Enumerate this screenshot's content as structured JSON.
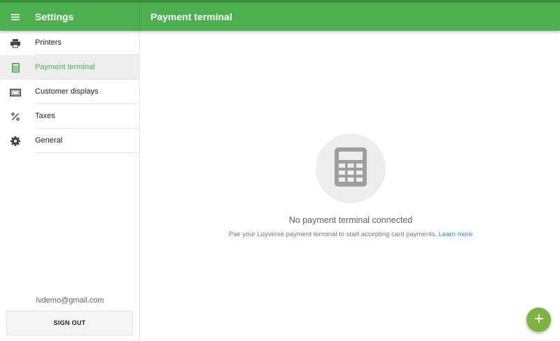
{
  "app": {
    "title": "Settings",
    "page_title": "Payment terminal"
  },
  "colors": {
    "primary": "#4caf50",
    "accent_fab": "#7cb342",
    "link": "#1e88e5"
  },
  "sidebar": {
    "items": [
      {
        "label": "Printers",
        "icon": "printer-icon",
        "active": false
      },
      {
        "label": "Payment terminal",
        "icon": "calculator-icon",
        "active": true
      },
      {
        "label": "Customer displays",
        "icon": "display-icon",
        "active": false
      },
      {
        "label": "Taxes",
        "icon": "percent-icon",
        "active": false
      },
      {
        "label": "General",
        "icon": "gear-icon",
        "active": false
      }
    ],
    "account_email": "lvdemo@gmail.com",
    "sign_out_label": "SIGN OUT"
  },
  "main": {
    "empty_icon": "calculator-icon",
    "empty_title": "No payment terminal connected",
    "empty_description": "Pair your Loyverse payment terminal to start accepting card payments.",
    "learn_more_label": "Learn more"
  },
  "fab": {
    "icon": "plus-icon"
  }
}
